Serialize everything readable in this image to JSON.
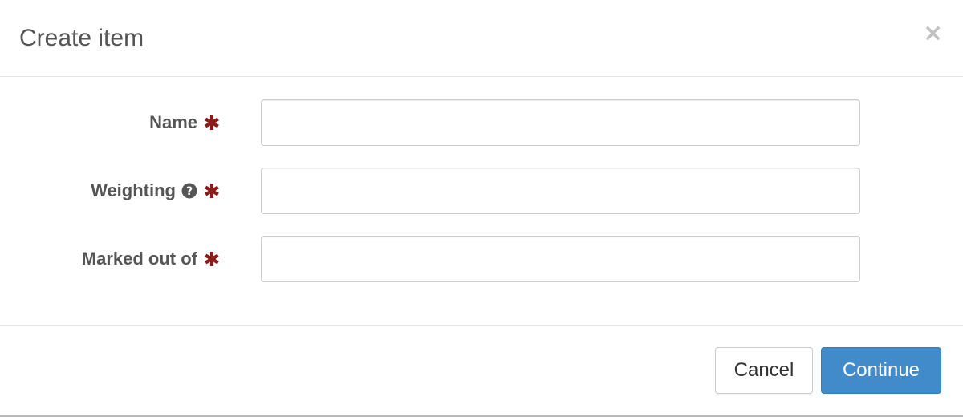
{
  "dialog": {
    "title": "Create item",
    "close_label": "×"
  },
  "form": {
    "fields": [
      {
        "label": "Name",
        "required": true,
        "help": false,
        "value": "",
        "placeholder": ""
      },
      {
        "label": "Weighting",
        "required": true,
        "help": true,
        "value": "",
        "placeholder": ""
      },
      {
        "label": "Marked out of",
        "required": true,
        "help": false,
        "value": "",
        "placeholder": ""
      }
    ]
  },
  "footer": {
    "cancel_label": "Cancel",
    "continue_label": "Continue"
  },
  "icons": {
    "required": "asterisk-icon",
    "help": "question-circle-icon",
    "close": "close-icon"
  },
  "colors": {
    "required_mark": "#8b1a1a",
    "primary_button": "#428bca",
    "text": "#555555"
  }
}
